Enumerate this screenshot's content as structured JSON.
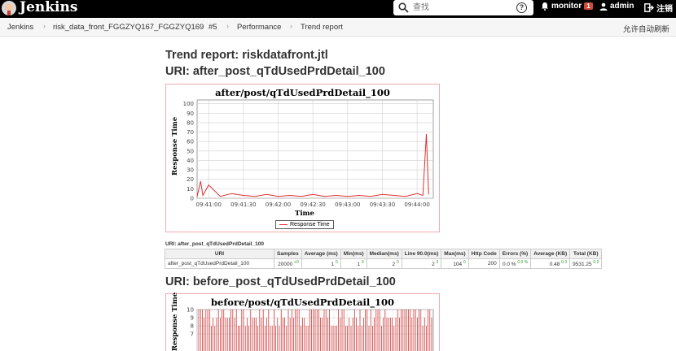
{
  "topbar": {
    "brand": "Jenkins",
    "search_placeholder": "查找",
    "help_label": "?",
    "user_menu": "monitor",
    "notification_count": "1",
    "user": "admin",
    "logout": "注销"
  },
  "breadcrumbs": [
    "Jenkins",
    "risk_data_front_FGGZYQ167_FGGZYQ169",
    "#5",
    "Performance",
    "Trend report"
  ],
  "refresh_label": "允许自动刷新",
  "page": {
    "title": "Trend report: riskdatafront.jtl",
    "section1_title": "URI: after_post_qTdUsedPrdDetail_100",
    "section2_title": "URI: before_post_qTdUsedPrdDetail_100"
  },
  "chart_data": [
    {
      "type": "line",
      "title": "after/post/qTdUsedPrdDetail_100",
      "xlabel": "Time",
      "ylabel": "Response Time",
      "yticks": [
        "0",
        "10",
        "20",
        "30",
        "40",
        "50",
        "60",
        "70",
        "80",
        "90",
        "100"
      ],
      "xticks": [
        "09:41:00",
        "09:41:30",
        "09:42:00",
        "09:42:30",
        "09:43:00",
        "09:43:30",
        "09:44:00"
      ],
      "ylim": [
        0,
        104
      ],
      "grid": true,
      "legend": "bottom-center",
      "series": [
        {
          "name": "Response Time",
          "color": "#e03030",
          "x": [
            "09:40:50",
            "09:40:53",
            "09:40:55",
            "09:41:00",
            "09:41:10",
            "09:41:20",
            "09:41:30",
            "09:41:40",
            "09:41:50",
            "09:42:00",
            "09:42:10",
            "09:42:20",
            "09:42:30",
            "09:42:40",
            "09:42:50",
            "09:43:00",
            "09:43:10",
            "09:43:20",
            "09:43:30",
            "09:43:40",
            "09:43:50",
            "09:44:00",
            "09:44:05",
            "09:44:08",
            "09:44:10"
          ],
          "values": [
            2,
            18,
            3,
            14,
            2,
            5,
            3,
            2,
            4,
            2,
            3,
            2,
            4,
            2,
            3,
            2,
            3,
            2,
            4,
            3,
            2,
            5,
            3,
            68,
            4
          ]
        }
      ]
    },
    {
      "type": "bar",
      "title": "before/post/qTdUsedPrdDetail_100",
      "xlabel": "",
      "ylabel": "Response Time",
      "yticks": [
        "7",
        "8",
        "9",
        "10"
      ],
      "ylim": [
        7,
        10
      ],
      "grid": true,
      "series": [
        {
          "name": "",
          "color": "#cc2222"
        }
      ]
    }
  ],
  "stats_table": {
    "title": "URI: after_post_qTdUsedPrdDetail_100",
    "headers": [
      "URI",
      "Samples",
      "Average (ms)",
      "Min(ms)",
      "Median(ms)",
      "Line 90.0(ms)",
      "Max(ms)",
      "Http Code",
      "Errors (%)",
      "Average (KB)",
      "Total (KB)"
    ],
    "row": {
      "uri": "after_post_qTdUsedPrdDetail_100",
      "samples": "20000",
      "samples_delta": "+0",
      "average": "1",
      "average_delta": "0",
      "min": "1",
      "min_delta": "0",
      "median": "2",
      "median_delta": "0",
      "line90": "2",
      "line90_delta": "0",
      "max": "104",
      "max_delta": "0",
      "http_code": "200",
      "errors": "0.0 %",
      "errors_delta": "0.0 %",
      "avg_kb": "0.48",
      "avg_kb_delta": "0.0",
      "total_kb": "9531.25",
      "total_kb_delta": "0.0"
    }
  }
}
